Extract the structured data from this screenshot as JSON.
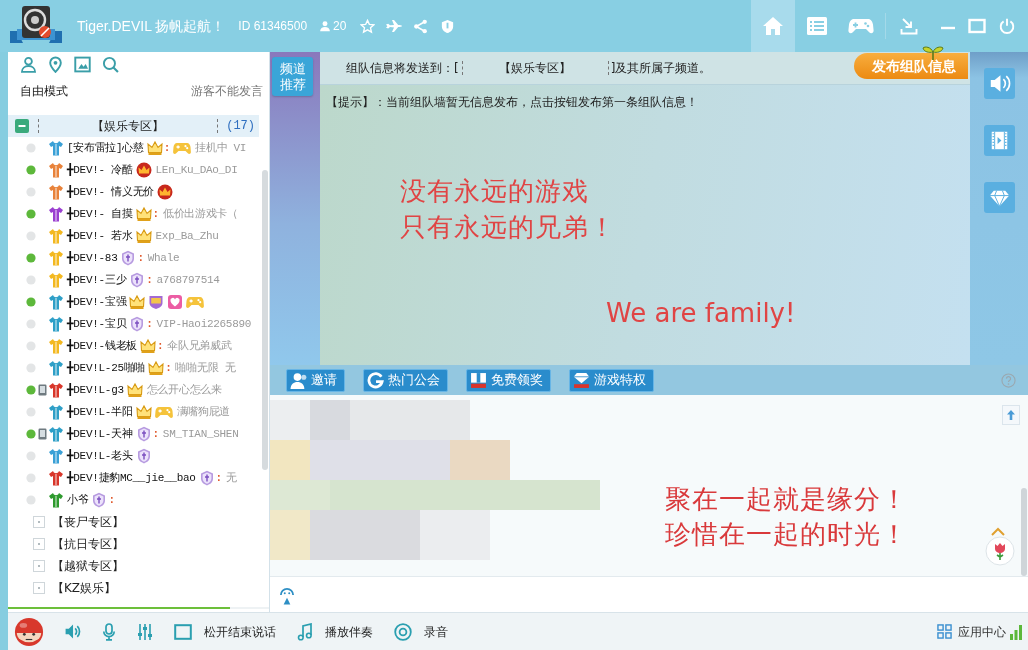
{
  "title_bar": {
    "title": "Tiger.DEVIL 扬帆起航！",
    "id": "ID 61346500",
    "members": "20",
    "nav": [
      {
        "kind": "home",
        "selected": true
      },
      {
        "kind": "list",
        "selected": false
      },
      {
        "kind": "games",
        "selected": false
      }
    ]
  },
  "sidebar": {
    "mode": "自由模式",
    "notice": "游客不能发言",
    "groups": [
      {
        "name": "【娱乐专区】",
        "count": "(17)",
        "expanded": true,
        "selected": true,
        "children": [
          {
            "name": "[安布雷拉]心慈",
            "online": false,
            "mobile": false,
            "color": "#3aa0d6",
            "badges": [
              {
                "kind": "crown",
                "suffix": ":"
              },
              {
                "kind": "gamepad"
              }
            ],
            "signature": "挂机中 VI"
          },
          {
            "name": "╋DEV!- 冷酷",
            "online": true,
            "mobile": false,
            "color": "#e8823a",
            "badges": [
              {
                "kind": "red-crown"
              }
            ],
            "signature": "LEn_Ku_DAo_DI"
          },
          {
            "name": "╋DEV!- 情义无价",
            "online": false,
            "mobile": false,
            "color": "#e8823a",
            "badges": [
              {
                "kind": "red-crown"
              }
            ]
          },
          {
            "name": "╋DEV!- 自摸",
            "online": true,
            "mobile": false,
            "color": "#9a3fd0",
            "badges": [
              {
                "kind": "crown",
                "suffix": ":"
              }
            ],
            "signature": "低价出游戏卡（"
          },
          {
            "name": "╋DEV!- 若水",
            "online": false,
            "mobile": false,
            "color": "#f3b820",
            "badges": [
              {
                "kind": "crown"
              }
            ],
            "signature": "Exp_Ba_Zhu"
          },
          {
            "name": "╋DEV!-83",
            "online": true,
            "mobile": false,
            "color": "#f3b820",
            "badges": [
              {
                "kind": "shield",
                "suffix": ":"
              }
            ],
            "signature": "Whale"
          },
          {
            "name": "╋DEV!-三少",
            "online": false,
            "mobile": false,
            "color": "#f3b820",
            "badges": [
              {
                "kind": "shield",
                "suffix": ":"
              }
            ],
            "signature": "a768797514"
          },
          {
            "name": "╋DEV!-宝强",
            "online": true,
            "mobile": false,
            "color": "#2e9fc7",
            "badges": [
              {
                "kind": "crown"
              },
              {
                "kind": "emblem"
              },
              {
                "kind": "heart"
              },
              {
                "kind": "gamepad"
              }
            ]
          },
          {
            "name": "╋DEV!-宝贝",
            "online": false,
            "mobile": false,
            "color": "#2e9fc7",
            "badges": [
              {
                "kind": "shield",
                "suffix": ":"
              }
            ],
            "signature": "VIP-Haoi2265890"
          },
          {
            "name": "╋DEV!-钱老板",
            "online": false,
            "mobile": false,
            "color": "#f3b820",
            "badges": [
              {
                "kind": "crown",
                "suffix": ":"
              }
            ],
            "signature": "伞队兄弟威武"
          },
          {
            "name": "╋DEV!L-25啪啪",
            "online": false,
            "mobile": false,
            "color": "#2e9fc7",
            "badges": [
              {
                "kind": "crown",
                "suffix": ":"
              }
            ],
            "signature": "啪啪无限 无"
          },
          {
            "name": "╋DEV!L-g3",
            "online": true,
            "mobile": true,
            "color": "#d8362a",
            "badges": [
              {
                "kind": "crown"
              }
            ],
            "signature": "怎么开心怎么来"
          },
          {
            "name": "╋DEV!L-半阳",
            "online": false,
            "mobile": false,
            "color": "#2e9fc7",
            "badges": [
              {
                "kind": "crown"
              },
              {
                "kind": "gamepad"
              }
            ],
            "signature": "满嘴狗屁道"
          },
          {
            "name": "╋DEV!L-天神",
            "online": true,
            "mobile": true,
            "color": "#2e9fc7",
            "badges": [
              {
                "kind": "shield",
                "suffix": ":"
              }
            ],
            "signature": "SM_TIAN_SHEN"
          },
          {
            "name": "╋DEV!L-老头",
            "online": false,
            "mobile": false,
            "color": "#3aa0d6",
            "badges": [
              {
                "kind": "shield"
              }
            ]
          },
          {
            "name": "╋DEV!捷豹MC__jie__bao",
            "online": false,
            "mobile": false,
            "color": "#d8362a",
            "badges": [
              {
                "kind": "shield",
                "suffix": ":"
              }
            ],
            "signature": "无"
          },
          {
            "name": "小爷",
            "online": false,
            "mobile": false,
            "color": "#2e9a2e",
            "badges": [
              {
                "kind": "shield",
                "suffix": ":"
              }
            ]
          }
        ]
      },
      {
        "name": "【丧尸专区】",
        "expanded": false,
        "selected": false
      },
      {
        "name": "【抗日专区】",
        "expanded": false,
        "selected": false
      },
      {
        "name": "【越狱专区】",
        "expanded": false,
        "selected": false
      },
      {
        "name": "【KZ娱乐】",
        "expanded": false,
        "selected": false
      }
    ],
    "voice_meter": {
      "level": 0.85
    }
  },
  "channel_button": "频道推荐",
  "team_wall": {
    "target_prefix": "组队信息将发送到：[",
    "target_channel": "【娱乐专区】",
    "target_suffix": "]及其所属子频道。",
    "publish_button": "发布组队信息",
    "hint": "【提示】：当前组队墙暂无信息发布，点击按钮发布第一条组队信息！",
    "lines": [
      "没有永远的游戏",
      "只有永远的兄弟！"
    ],
    "motto": "We are family!"
  },
  "action_buttons": [
    {
      "kind": "invite",
      "label": "邀请"
    },
    {
      "kind": "guild",
      "label": "热门公会"
    },
    {
      "kind": "reward",
      "label": "免费领奖"
    },
    {
      "kind": "privilege",
      "label": "游戏特权"
    }
  ],
  "chat": {
    "lines": [
      "聚在一起就是缘分！",
      "珍惜在一起的时光！"
    ]
  },
  "toolbar": [
    {
      "kind": "push-to-talk",
      "label": "松开结束说话"
    },
    {
      "kind": "music",
      "label": "播放伴奏"
    },
    {
      "kind": "record",
      "label": "录音"
    }
  ],
  "app_center": "应用中心"
}
